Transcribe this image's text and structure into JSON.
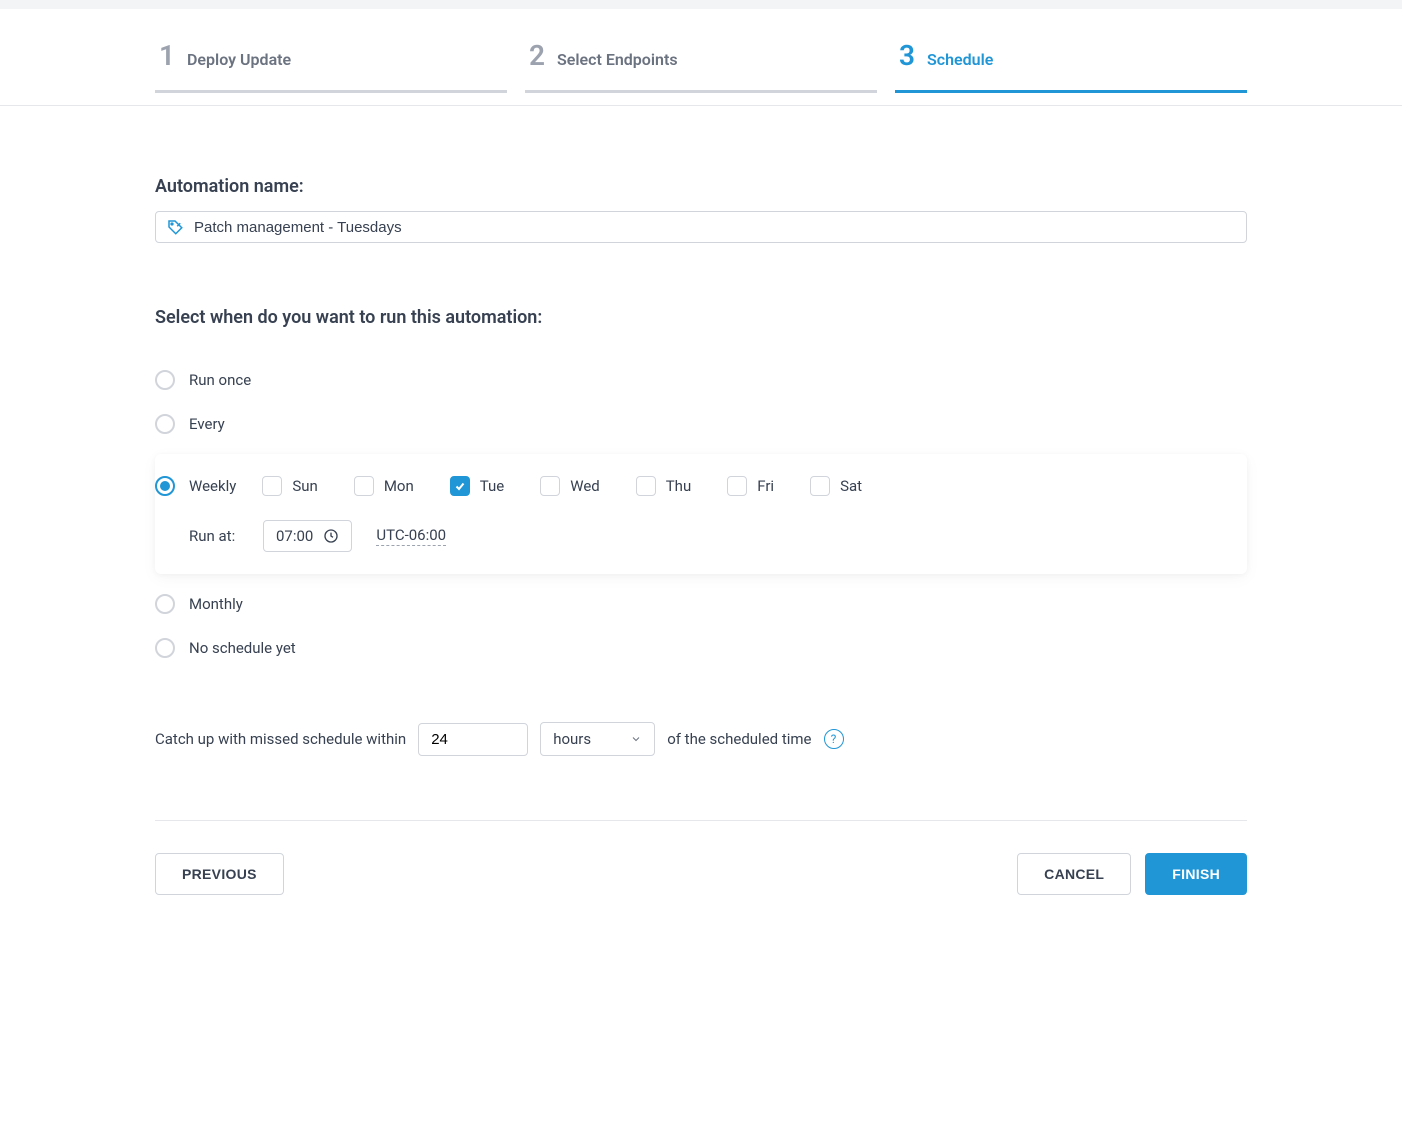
{
  "stepper": {
    "steps": [
      {
        "num": "1",
        "label": "Deploy Update"
      },
      {
        "num": "2",
        "label": "Select Endpoints"
      },
      {
        "num": "3",
        "label": "Schedule"
      }
    ]
  },
  "automation_name": {
    "label": "Automation name:",
    "value": "Patch management - Tuesdays"
  },
  "schedule": {
    "question": "Select when do you want to run this automation:",
    "options": {
      "run_once": "Run once",
      "every": "Every",
      "weekly": "Weekly",
      "monthly": "Monthly",
      "no_schedule": "No schedule yet"
    },
    "days": [
      {
        "label": "Sun",
        "checked": false
      },
      {
        "label": "Mon",
        "checked": false
      },
      {
        "label": "Tue",
        "checked": true
      },
      {
        "label": "Wed",
        "checked": false
      },
      {
        "label": "Thu",
        "checked": false
      },
      {
        "label": "Fri",
        "checked": false
      },
      {
        "label": "Sat",
        "checked": false
      }
    ],
    "run_at_label": "Run at:",
    "run_at_time": "07:00",
    "timezone": "UTC-06:00"
  },
  "catchup": {
    "prefix": "Catch up with missed schedule within",
    "value": "24",
    "unit": "hours",
    "suffix": "of the scheduled time"
  },
  "footer": {
    "previous": "PREVIOUS",
    "cancel": "CANCEL",
    "finish": "FINISH"
  }
}
